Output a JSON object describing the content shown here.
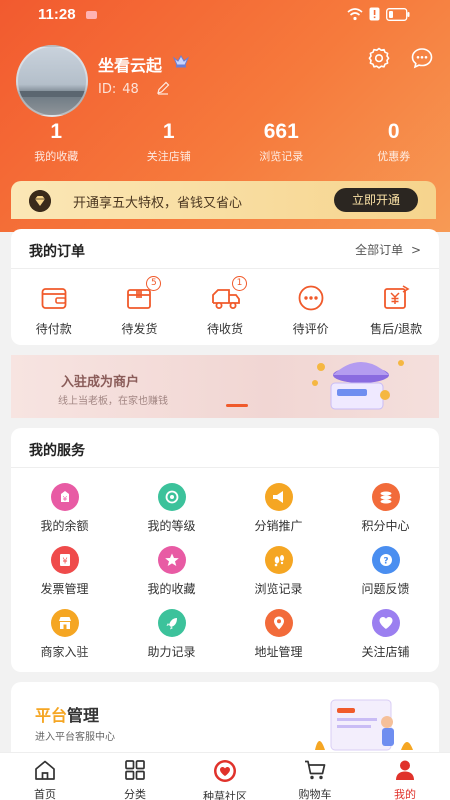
{
  "status_bar": {
    "time": "11:28"
  },
  "profile": {
    "name": "坐看云起",
    "id_label": "ID:",
    "id_value": "48"
  },
  "stats": [
    {
      "num": "1",
      "label": "我的收藏"
    },
    {
      "num": "1",
      "label": "关注店铺"
    },
    {
      "num": "661",
      "label": "浏览记录"
    },
    {
      "num": "0",
      "label": "优惠券"
    }
  ],
  "vip": {
    "text": "开通享五大特权，省钱又省心",
    "button": "立即开通"
  },
  "orders": {
    "title": "我的订单",
    "all": "全部订单",
    "items": [
      {
        "label": "待付款",
        "icon": "wallet-icon",
        "badge": ""
      },
      {
        "label": "待发货",
        "icon": "package-icon",
        "badge": "5"
      },
      {
        "label": "待收货",
        "icon": "truck-icon",
        "badge": "1"
      },
      {
        "label": "待评价",
        "icon": "chat-dots-icon",
        "badge": ""
      },
      {
        "label": "售后/退款",
        "icon": "refund-icon",
        "badge": ""
      }
    ]
  },
  "banner": {
    "title": "入驻成为商户",
    "subtitle": "线上当老板，在家也赚钱"
  },
  "services": {
    "title": "我的服务",
    "items": [
      {
        "label": "我的余额",
        "icon": "balance-icon",
        "color": "#e85ba4"
      },
      {
        "label": "我的等级",
        "icon": "level-icon",
        "color": "#3cc29b"
      },
      {
        "label": "分销推广",
        "icon": "megaphone-icon",
        "color": "#f5a623"
      },
      {
        "label": "积分中心",
        "icon": "coins-icon",
        "color": "#f26b3a"
      },
      {
        "label": "发票管理",
        "icon": "invoice-icon",
        "color": "#ef4b4b"
      },
      {
        "label": "我的收藏",
        "icon": "star-icon",
        "color": "#e85ba4"
      },
      {
        "label": "浏览记录",
        "icon": "footprint-icon",
        "color": "#f5a623"
      },
      {
        "label": "问题反馈",
        "icon": "question-icon",
        "color": "#4a8ef0"
      },
      {
        "label": "商家入驻",
        "icon": "store-icon",
        "color": "#f5a623"
      },
      {
        "label": "助力记录",
        "icon": "rocket-icon",
        "color": "#3cc29b"
      },
      {
        "label": "地址管理",
        "icon": "location-icon",
        "color": "#f26b3a"
      },
      {
        "label": "关注店铺",
        "icon": "heart-icon",
        "color": "#9b7ff0"
      }
    ]
  },
  "platform": {
    "title_highlight": "平台",
    "title_rest": "管理",
    "subtitle": "进入平台客服中心"
  },
  "tabbar": [
    {
      "label": "首页",
      "icon": "home-icon",
      "active": false
    },
    {
      "label": "分类",
      "icon": "grid-icon",
      "active": false
    },
    {
      "label": "种草社区",
      "icon": "community-icon",
      "active": false
    },
    {
      "label": "购物车",
      "icon": "cart-icon",
      "active": false
    },
    {
      "label": "我的",
      "icon": "user-icon",
      "active": true
    }
  ]
}
